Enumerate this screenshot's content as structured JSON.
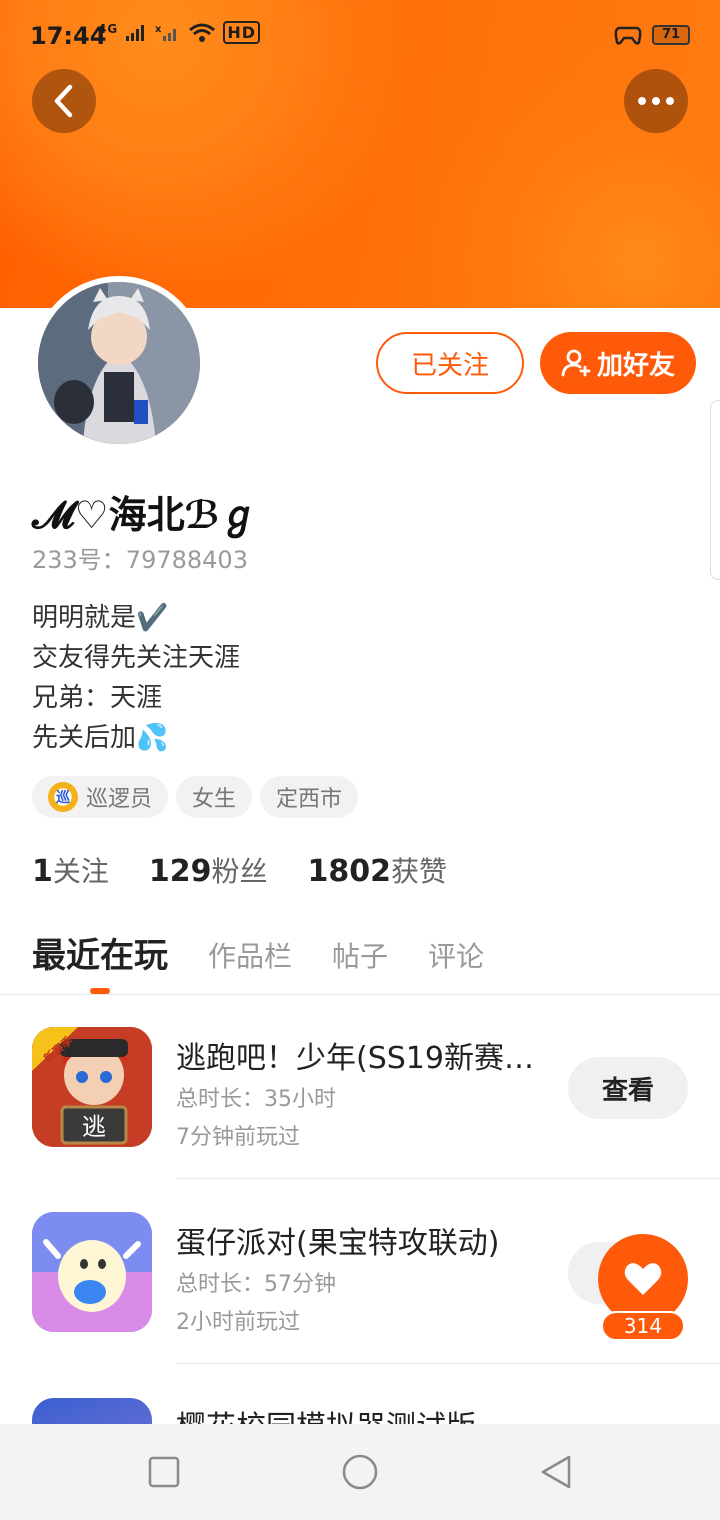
{
  "status_bar": {
    "time": "17:44",
    "network": "4G",
    "wifi_label": "HD",
    "battery": "71"
  },
  "header": {
    "back_icon": "chevron-left-icon",
    "more_icon": "more-dots-icon"
  },
  "profile": {
    "nickname": "𝓜♡海北ℬℊ",
    "uid": "233号：79788403",
    "bio_lines": [
      "明明就是✔️",
      "交友得先关注天涯",
      "兄弟：天涯",
      "先关后加💦"
    ],
    "follow_label": "已关注",
    "add_friend_label": "加好友",
    "tags": [
      {
        "label": "巡逻员",
        "badge": "巡"
      },
      {
        "label": "女生"
      },
      {
        "label": "定西市"
      }
    ],
    "stats": [
      {
        "value": "1",
        "label": "关注"
      },
      {
        "value": "129",
        "label": "粉丝"
      },
      {
        "value": "1802",
        "label": "获赞"
      }
    ]
  },
  "tabs": [
    {
      "label": "最近在玩",
      "active": true
    },
    {
      "label": "作品栏",
      "active": false
    },
    {
      "label": "帖子",
      "active": false
    },
    {
      "label": "评论",
      "active": false
    }
  ],
  "games": [
    {
      "title": "逃跑吧！少年(SS19新赛…",
      "duration": "总时长：35小时",
      "last_played": "7分钟前玩过",
      "action": "查看",
      "icon_badge": "新赛季",
      "icon_char": "逃"
    },
    {
      "title": "蛋仔派对(果宝特攻联动)",
      "duration": "总时长：57分钟",
      "last_played": "2小时前玩过",
      "action": "查看"
    },
    {
      "title": "樱花校园模拟器测试版"
    }
  ],
  "like": {
    "count": "314"
  },
  "colors": {
    "accent": "#ff5a0a",
    "banner": "#ff6d08"
  }
}
